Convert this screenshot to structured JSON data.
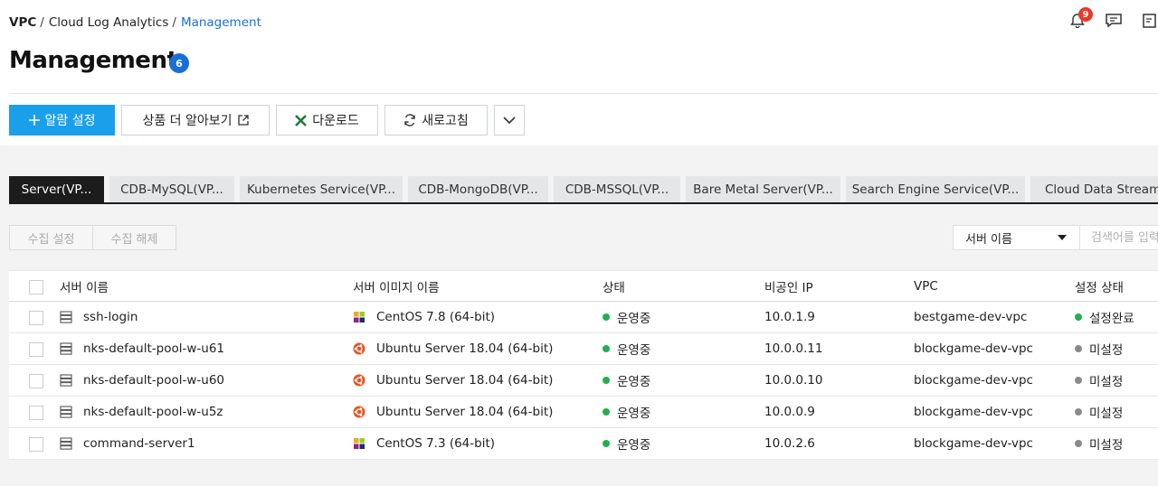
{
  "breadcrumb": {
    "items": [
      "VPC",
      "Cloud Log Analytics",
      "Management"
    ],
    "separator": "/"
  },
  "header": {
    "notification_count": "9",
    "icons": [
      "bell-icon",
      "chat-icon",
      "memo-icon"
    ]
  },
  "page": {
    "title": "Management",
    "count": "6"
  },
  "toolbar": {
    "alarm_label": "알람 설정",
    "learn_label": "상품 더 알아보기",
    "download_label": "다운로드",
    "refresh_label": "새로고침"
  },
  "tabs": [
    {
      "label": "Server(VP...",
      "active": true
    },
    {
      "label": "CDB-MySQL(VP...",
      "active": false
    },
    {
      "label": "Kubernetes Service(VP...",
      "active": false
    },
    {
      "label": "CDB-MongoDB(VP...",
      "active": false
    },
    {
      "label": "CDB-MSSQL(VP...",
      "active": false
    },
    {
      "label": "Bare Metal Server(VP...",
      "active": false
    },
    {
      "label": "Search Engine Service(VP...",
      "active": false
    },
    {
      "label": "Cloud Data Streaming",
      "active": false
    }
  ],
  "actions": {
    "collect_set": "수집 설정",
    "collect_release": "수집 해제"
  },
  "search": {
    "field_selected": "서버 이름",
    "placeholder": "검색어를 입력"
  },
  "table": {
    "columns": [
      "서버 이름",
      "서버 이미지 이름",
      "상태",
      "비공인 IP",
      "VPC",
      "설정 상태"
    ],
    "rows": [
      {
        "name": "ssh-login",
        "image": "CentOS 7.8 (64-bit)",
        "os": "centos",
        "status": "운영중",
        "ip": "10.0.1.9",
        "vpc": "bestgame-dev-vpc",
        "setting": "설정완료",
        "setting_color": "#22b14c"
      },
      {
        "name": "nks-default-pool-w-u61",
        "image": "Ubuntu Server 18.04 (64-bit)",
        "os": "ubuntu",
        "status": "운영중",
        "ip": "10.0.0.11",
        "vpc": "blockgame-dev-vpc",
        "setting": "미설정",
        "setting_color": "#8a8a8a"
      },
      {
        "name": "nks-default-pool-w-u60",
        "image": "Ubuntu Server 18.04 (64-bit)",
        "os": "ubuntu",
        "status": "운영중",
        "ip": "10.0.0.10",
        "vpc": "blockgame-dev-vpc",
        "setting": "미설정",
        "setting_color": "#8a8a8a"
      },
      {
        "name": "nks-default-pool-w-u5z",
        "image": "Ubuntu Server 18.04 (64-bit)",
        "os": "ubuntu",
        "status": "운영중",
        "ip": "10.0.0.9",
        "vpc": "blockgame-dev-vpc",
        "setting": "미설정",
        "setting_color": "#8a8a8a"
      },
      {
        "name": "command-server1",
        "image": "CentOS 7.3 (64-bit)",
        "os": "centos",
        "status": "운영중",
        "ip": "10.0.2.6",
        "vpc": "blockgame-dev-vpc",
        "setting": "미설정",
        "setting_color": "#8a8a8a"
      }
    ]
  },
  "colors": {
    "accent": "#1aa0ea",
    "link": "#1a6fd6",
    "running": "#22b14c",
    "excel": "#1e7a3c",
    "notification": "#e8392b"
  }
}
